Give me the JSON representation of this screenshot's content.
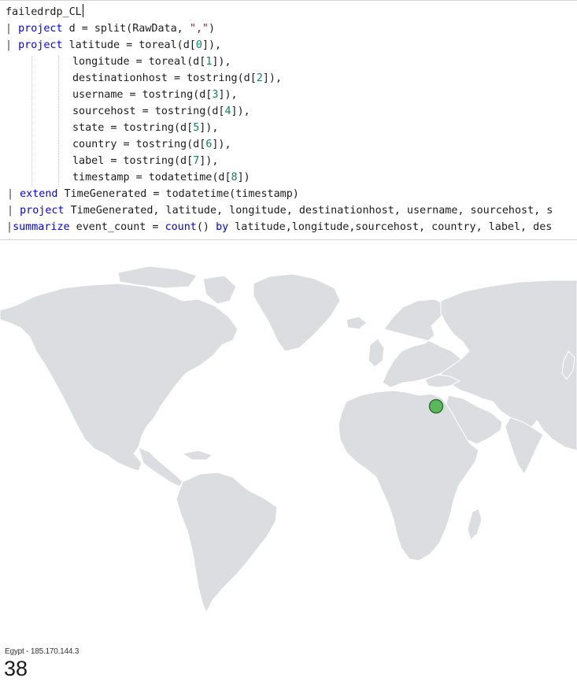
{
  "editor": {
    "lines": [
      {
        "pipe": "",
        "kw": "",
        "text": "failedrdp_CL"
      },
      {
        "pipe": "| ",
        "kw": "project",
        "pre": " d = split(RawData, ",
        "str": "\",\"",
        "post": ")"
      },
      {
        "pipe": "| ",
        "kw": "project",
        "pre": " latitude = toreal(d[",
        "num": "0",
        "post": "]),"
      },
      {
        "pipe": "",
        "kw": "",
        "pre": "longitude = toreal(d[",
        "num": "1",
        "post": "]),"
      },
      {
        "pipe": "",
        "kw": "",
        "pre": "destinationhost = tostring(d[",
        "num": "2",
        "post": "]),"
      },
      {
        "pipe": "",
        "kw": "",
        "pre": "username = tostring(d[",
        "num": "3",
        "post": "]),"
      },
      {
        "pipe": "",
        "kw": "",
        "pre": "sourcehost = tostring(d[",
        "num": "4",
        "post": "]),"
      },
      {
        "pipe": "",
        "kw": "",
        "pre": "state = tostring(d[",
        "num": "5",
        "post": "]),"
      },
      {
        "pipe": "",
        "kw": "",
        "pre": "country = tostring(d[",
        "num": "6",
        "post": "]),"
      },
      {
        "pipe": "",
        "kw": "",
        "pre": "label = tostring(d[",
        "num": "7",
        "post": "]),"
      },
      {
        "pipe": "",
        "kw": "",
        "pre": "timestamp = todatetime(d[",
        "num": "8",
        "post": "])"
      },
      {
        "pipe": "| ",
        "kw": "extend",
        "pre": " TimeGenerated = todatetime(timestamp)",
        "num": "",
        "post": ""
      },
      {
        "pipe": "| ",
        "kw": "project",
        "pre": " TimeGenerated, latitude, longitude, destinationhost, username, sourcehost, s",
        "num": "",
        "post": ""
      },
      {
        "pipe": "|",
        "kw": "summarize",
        "pre": " event_count = ",
        "kw2": "count",
        "mid": "() ",
        "kw3": "by",
        "post": " latitude,longitude,sourcehost, country, label, des"
      }
    ]
  },
  "map": {
    "marker_label": "Egypt - 185.170.144.3",
    "land_color": "#dcdde0",
    "marker_color": "#5cb85c",
    "marker_lat": 26.8,
    "marker_lon": 30.8
  },
  "tile": {
    "label": "Egypt - 185.170.144.3",
    "count": "38"
  }
}
